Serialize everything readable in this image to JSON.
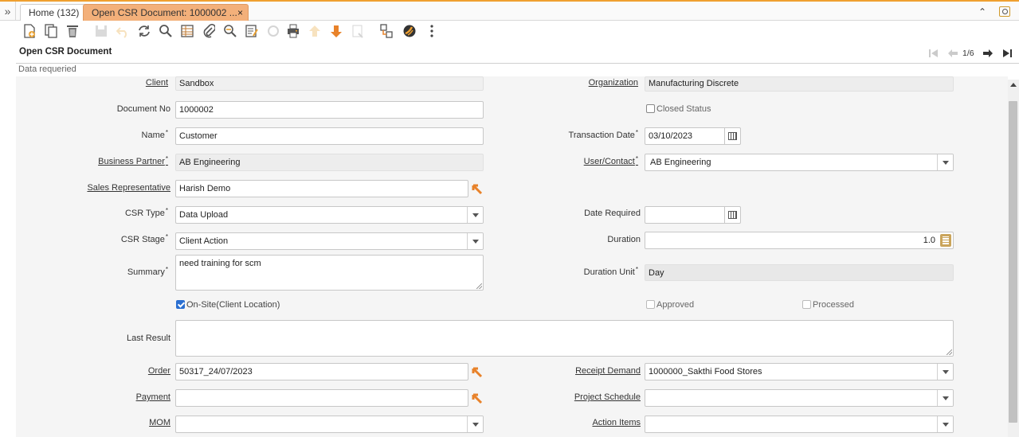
{
  "tabs": {
    "home_label": "Home (132)",
    "active_label": "Open CSR Document: 1000002 ...",
    "active_close": "×"
  },
  "header": {
    "title": "Open CSR Document",
    "record_counter": "1/6",
    "status_message": "Data requeried"
  },
  "toolbar": {
    "icons": [
      "new-record-icon",
      "copy-record-icon",
      "delete-icon",
      "save-icon",
      "undo-icon",
      "refresh-icon",
      "find-icon",
      "grid-toggle-icon",
      "attachment-icon",
      "zoom-across-icon",
      "report-icon",
      "workflow-icon",
      "print-icon",
      "parent-record-icon",
      "detail-record-icon",
      "archive-icon",
      "process-icon",
      "help-icon",
      "more-icon"
    ]
  },
  "form": {
    "client": {
      "label": "Client",
      "value": "Sandbox"
    },
    "organization": {
      "label": "Organization",
      "value": "Manufacturing Discrete"
    },
    "document_no": {
      "label": "Document No",
      "value": "1000002"
    },
    "closed_status": {
      "label": "Closed Status",
      "checked": false
    },
    "name": {
      "label": "Name",
      "value": "Customer"
    },
    "transaction_date": {
      "label": "Transaction Date",
      "value": "03/10/2023"
    },
    "business_partner": {
      "label": "Business Partner",
      "value": "AB Engineering"
    },
    "user_contact": {
      "label": "User/Contact",
      "value": "AB Engineering"
    },
    "sales_rep": {
      "label": "Sales Representative",
      "value": "Harish Demo"
    },
    "csr_type": {
      "label": "CSR Type",
      "value": "Data Upload"
    },
    "date_required": {
      "label": "Date Required",
      "value": ""
    },
    "csr_stage": {
      "label": "CSR Stage",
      "value": "Client Action"
    },
    "duration": {
      "label": "Duration",
      "value": "1.0"
    },
    "summary": {
      "label": "Summary",
      "value": "need training for scm"
    },
    "duration_unit": {
      "label": "Duration Unit",
      "value": "Day"
    },
    "on_site": {
      "label": "On-Site(Client Location)",
      "checked": true
    },
    "approved": {
      "label": "Approved",
      "checked": false
    },
    "processed": {
      "label": "Processed",
      "checked": false
    },
    "last_result": {
      "label": "Last Result",
      "value": ""
    },
    "order": {
      "label": "Order",
      "value": "50317_24/07/2023"
    },
    "receipt_demand": {
      "label": "Receipt Demand",
      "value": "1000000_Sakthi Food Stores"
    },
    "payment": {
      "label": "Payment",
      "value": ""
    },
    "project_schedule": {
      "label": "Project Schedule",
      "value": ""
    },
    "mom": {
      "label": "MOM",
      "value": ""
    },
    "action_items": {
      "label": "Action Items",
      "value": ""
    }
  },
  "colors": {
    "active_tab": "#f3b07a",
    "accent": "#f0a030",
    "checkbox_on": "#2a6fd1",
    "zoom_arrow": "#e8822a"
  }
}
